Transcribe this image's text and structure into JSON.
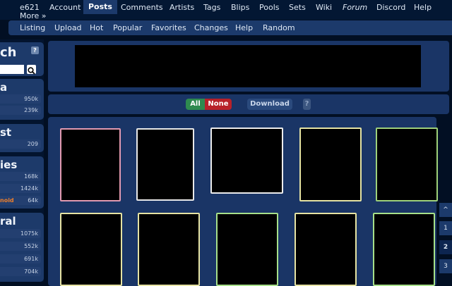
{
  "topnav": {
    "items": [
      "e621",
      "Account",
      "Posts",
      "Comments",
      "Artists",
      "Tags",
      "Blips",
      "Pools",
      "Sets",
      "Wiki",
      "Forum",
      "Discord",
      "Help"
    ],
    "more": "More »"
  },
  "subnav": {
    "items": [
      "Listing",
      "Upload",
      "Hot",
      "Popular",
      "Favorites",
      "Changes",
      "Help",
      "Random"
    ]
  },
  "sidebar": {
    "search_title": "ch",
    "help": "?",
    "sections": [
      {
        "title": "a",
        "rows": [
          {
            "name": "",
            "count": "950k"
          },
          {
            "name": "",
            "count": "239k"
          }
        ]
      },
      {
        "title": "st",
        "rows": [
          {
            "name": "",
            "count": "209"
          }
        ]
      },
      {
        "title": "ies",
        "rows": [
          {
            "name": "",
            "count": "168k"
          },
          {
            "name": "",
            "count": "1424k"
          },
          {
            "name": "noid",
            "count": "64k"
          }
        ]
      },
      {
        "title": "ral",
        "rows": [
          {
            "name": "",
            "count": "1075k"
          },
          {
            "name": "",
            "count": "552k"
          },
          {
            "name": "",
            "count": "691k"
          },
          {
            "name": "",
            "count": "704k"
          }
        ]
      }
    ]
  },
  "toolbar": {
    "all": "All",
    "none": "None",
    "download": "Download",
    "help": "?"
  },
  "pagination": {
    "up": "^",
    "pages": [
      "1",
      "2",
      "3"
    ],
    "current": "2"
  },
  "colors": {
    "all_green": "#2e8a4f",
    "none_red": "#b8212a",
    "tag_orange": "#ee7f2b"
  }
}
